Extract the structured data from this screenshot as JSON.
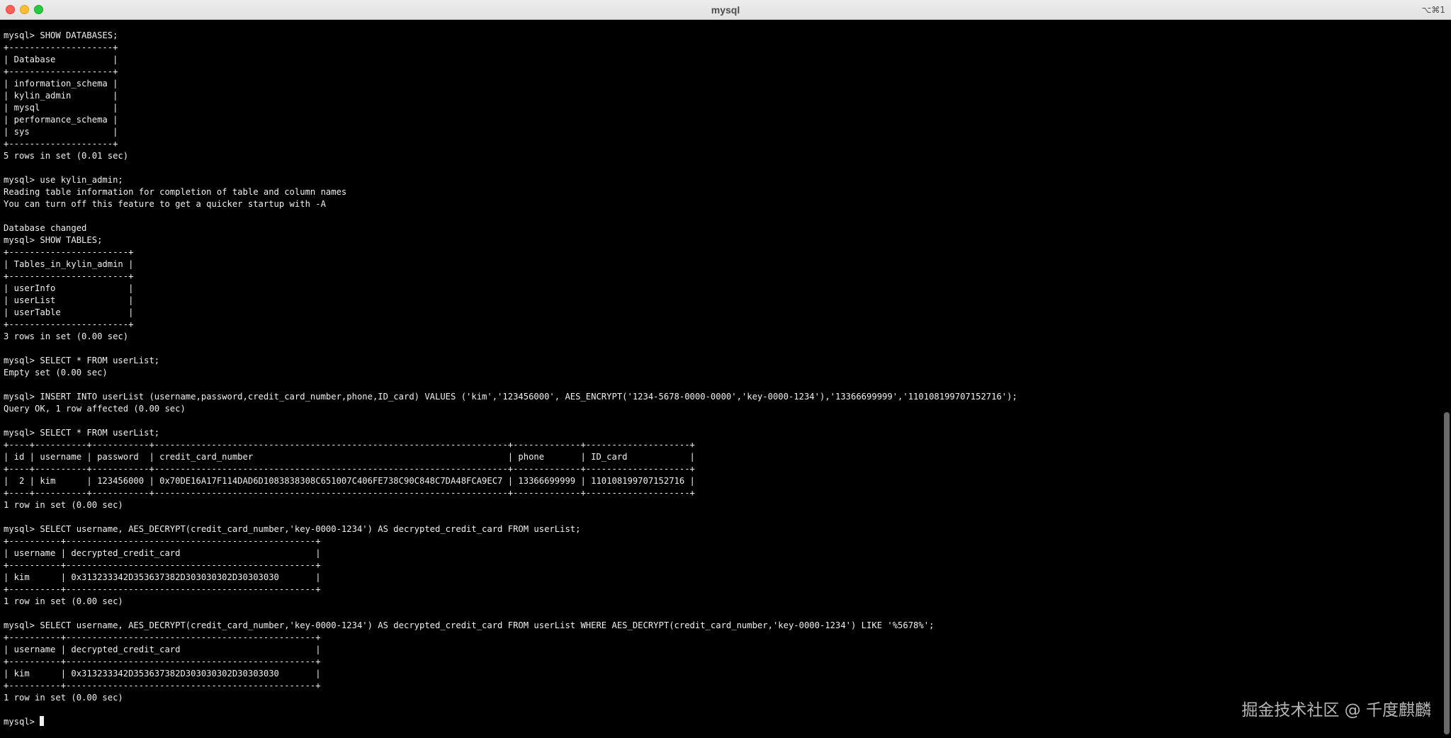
{
  "window": {
    "title": "mysql",
    "shortcut": "⌥⌘1"
  },
  "terminal": {
    "lines": [
      "mysql> SHOW DATABASES;",
      "+--------------------+",
      "| Database           |",
      "+--------------------+",
      "| information_schema |",
      "| kylin_admin        |",
      "| mysql              |",
      "| performance_schema |",
      "| sys                |",
      "+--------------------+",
      "5 rows in set (0.01 sec)",
      "",
      "mysql> use kylin_admin;",
      "Reading table information for completion of table and column names",
      "You can turn off this feature to get a quicker startup with -A",
      "",
      "Database changed",
      "mysql> SHOW TABLES;",
      "+-----------------------+",
      "| Tables_in_kylin_admin |",
      "+-----------------------+",
      "| userInfo              |",
      "| userList              |",
      "| userTable             |",
      "+-----------------------+",
      "3 rows in set (0.00 sec)",
      "",
      "mysql> SELECT * FROM userList;",
      "Empty set (0.00 sec)",
      "",
      "mysql> INSERT INTO userList (username,password,credit_card_number,phone,ID_card) VALUES ('kim','123456000', AES_ENCRYPT('1234-5678-0000-0000','key-0000-1234'),'13366699999','110108199707152716');",
      "Query OK, 1 row affected (0.00 sec)",
      "",
      "mysql> SELECT * FROM userList;",
      "+----+----------+-----------+--------------------------------------------------------------------+-------------+--------------------+",
      "| id | username | password  | credit_card_number                                                 | phone       | ID_card            |",
      "+----+----------+-----------+--------------------------------------------------------------------+-------------+--------------------+",
      "|  2 | kim      | 123456000 | 0x70DE16A17F114DAD6D1083838308C651007C406FE738C90C848C7DA48FCA9EC7 | 13366699999 | 110108199707152716 |",
      "+----+----------+-----------+--------------------------------------------------------------------+-------------+--------------------+",
      "1 row in set (0.00 sec)",
      "",
      "mysql> SELECT username, AES_DECRYPT(credit_card_number,'key-0000-1234') AS decrypted_credit_card FROM userList;",
      "+----------+------------------------------------------------+",
      "| username | decrypted_credit_card                          |",
      "+----------+------------------------------------------------+",
      "| kim      | 0x313233342D353637382D303030302D30303030       |",
      "+----------+------------------------------------------------+",
      "1 row in set (0.00 sec)",
      "",
      "mysql> SELECT username, AES_DECRYPT(credit_card_number,'key-0000-1234') AS decrypted_credit_card FROM userList WHERE AES_DECRYPT(credit_card_number,'key-0000-1234') LIKE '%5678%';",
      "+----------+------------------------------------------------+",
      "| username | decrypted_credit_card                          |",
      "+----------+------------------------------------------------+",
      "| kim      | 0x313233342D353637382D303030302D30303030       |",
      "+----------+------------------------------------------------+",
      "1 row in set (0.00 sec)",
      "",
      "mysql> "
    ]
  },
  "watermark": "掘金技术社区 @ 千度麒麟"
}
